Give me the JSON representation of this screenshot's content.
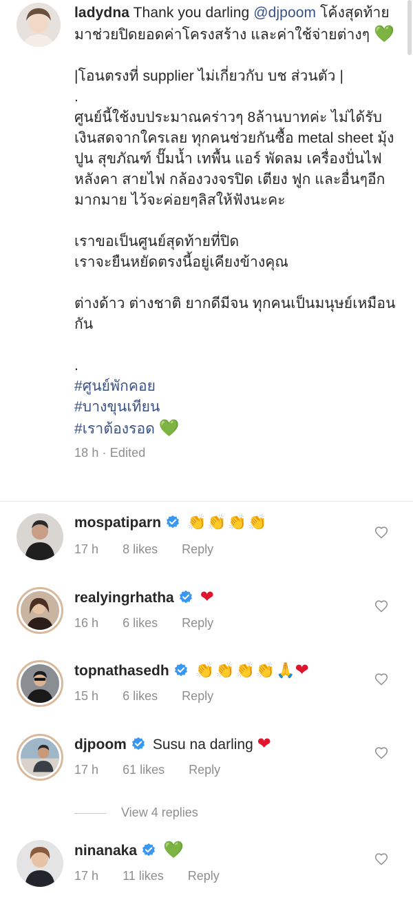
{
  "caption": {
    "username": "ladydna",
    "intro": "Thank you darling ",
    "mention": "@djpoom",
    "intro_rest": " โค้งสุดท้ายมาช่วยปิดยอดค่าโครงสร้าง และค่าใช้จ่ายต่างๆ ",
    "intro_emoji": "💚",
    "note": "|โอนตรงที่ supplier ไม่เกี่ยวกับ บช ส่วนตัว |",
    "dot1": ".",
    "paragraph1": "ศูนย์นี้ใช้งบประมาณคร่าวๆ 8ล้านบาทค่ะ ไม่ได้รับเงินสดจากใครเลย ทุกคนช่วยกันซื้อ metal sheet มุ้ง ปูน สุขภัณฑ์ ปั๊มน้ำ เทพื้น แอร์ พัดลม เครื่องปั่นไฟ หลังคา สายไฟ กล้องวงจรปิด เตียง ฟูก และอื่นๆอีกมากมาย ไว้จะค่อยๆลิสให้ฟังนะคะ",
    "paragraph2_line1": "เราขอเป็นศูนย์สุดท้ายที่ปิด",
    "paragraph2_line2": "เราจะยืนหยัดตรงนี้อยู่เคียงข้างคุณ",
    "paragraph3": "ต่างด้าว ต่างชาติ ยากดีมีจน ทุกคนเป็นมนุษย์เหมือนกัน",
    "dot2": ".",
    "hashtag1": "#ศูนย์พักคอย",
    "hashtag2": "#บางขุนเทียน",
    "hashtag3": "#เราต้องรอด",
    "hashtag3_emoji": "💚",
    "time": "18 h",
    "separator": "·",
    "edited": "Edited"
  },
  "comments": [
    {
      "username": "mospatiparn",
      "body": "👏👏👏👏",
      "time": "17 h",
      "likes": "8 likes",
      "reply": "Reply"
    },
    {
      "username": "realyingrhatha",
      "body": "❤",
      "time": "16 h",
      "likes": "6 likes",
      "reply": "Reply"
    },
    {
      "username": "topnathasedh",
      "body_claps": "👏👏👏👏",
      "body_pray": "🙏",
      "body_heart": "❤",
      "time": "15 h",
      "likes": "6 likes",
      "reply": "Reply"
    },
    {
      "username": "djpoom",
      "body": "Susu na darling ",
      "body_emoji": "❤",
      "time": "17 h",
      "likes": "61 likes",
      "reply": "Reply"
    },
    {
      "username": "ninanaka",
      "body": "💚",
      "time": "17 h",
      "likes": "11 likes",
      "reply": "Reply"
    }
  ],
  "view_replies": "View 4 replies",
  "colors": {
    "text": "#262626",
    "muted": "#8e8e8e",
    "link": "#385185",
    "verified": "#3897f0",
    "heart_red": "#e0142c",
    "heart_green": "#3fa83a"
  },
  "icons": {
    "verified": "verified-badge-icon",
    "like": "heart-outline-icon"
  }
}
